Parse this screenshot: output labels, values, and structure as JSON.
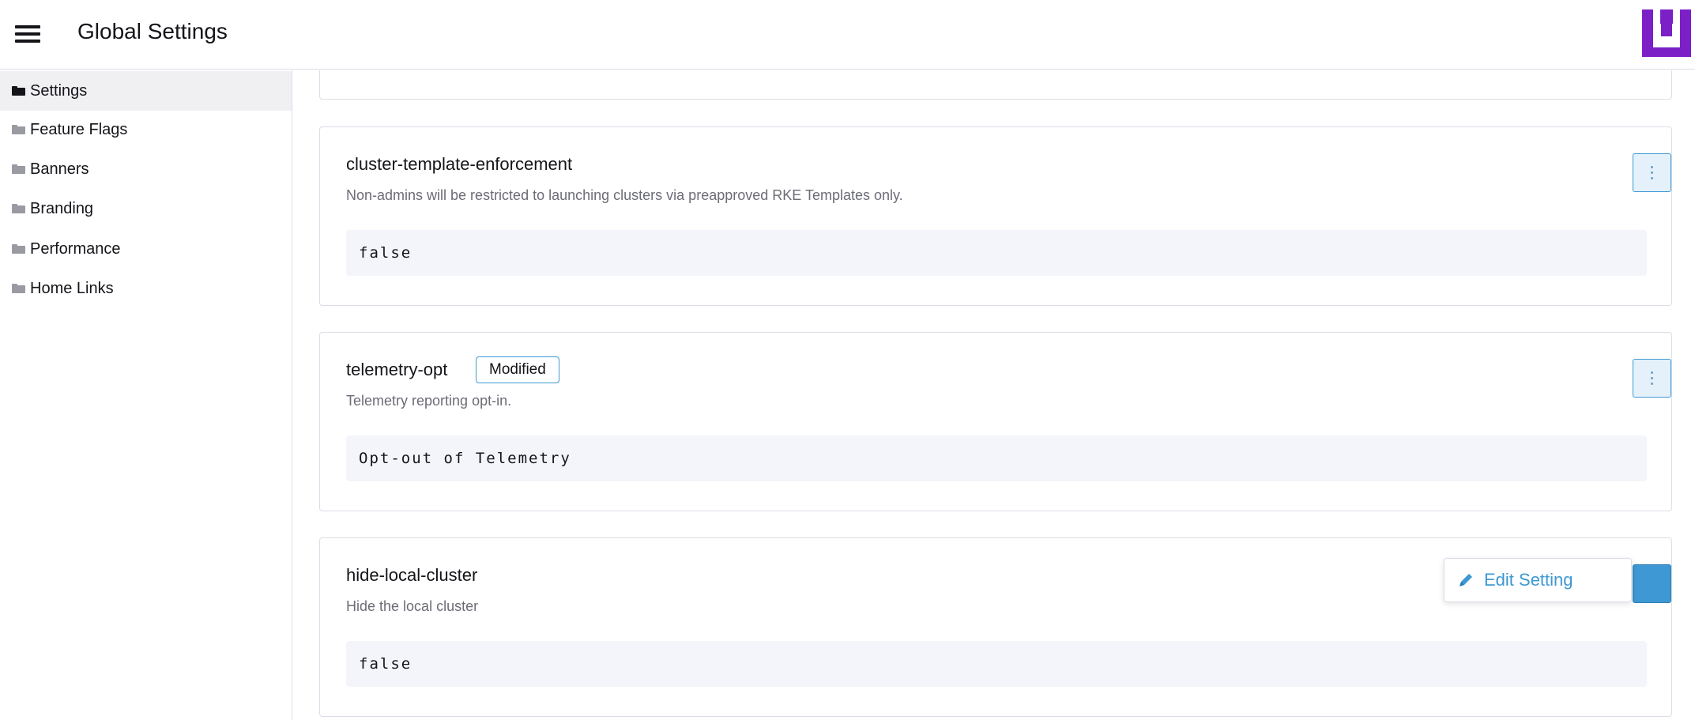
{
  "header": {
    "title": "Global Settings",
    "menu_icon": "hamburger-menu-icon",
    "logo_icon": "brand-logo-icon",
    "logo_color": "#7b1fc7"
  },
  "sidebar": {
    "items": [
      {
        "label": "Settings",
        "icon": "folder-open-icon",
        "active": true
      },
      {
        "label": "Feature Flags",
        "icon": "folder-icon",
        "active": false
      },
      {
        "label": "Banners",
        "icon": "folder-icon",
        "active": false
      },
      {
        "label": "Branding",
        "icon": "folder-icon",
        "active": false
      },
      {
        "label": "Performance",
        "icon": "folder-icon",
        "active": false
      },
      {
        "label": "Home Links",
        "icon": "folder-icon",
        "active": false
      }
    ]
  },
  "settings": [
    {
      "name": "cluster-template-enforcement",
      "description": "Non-admins will be restricted to launching clusters via preapproved RKE Templates only.",
      "value": "false"
    },
    {
      "name": "telemetry-opt",
      "badge": "Modified",
      "description": "Telemetry reporting opt-in.",
      "value": "Opt-out of Telemetry"
    },
    {
      "name": "hide-local-cluster",
      "description": "Hide the local cluster",
      "value": "false"
    }
  ],
  "action_menu": {
    "edit_label": "Edit Setting",
    "edit_icon": "pencil-icon"
  },
  "colors": {
    "accent": "#3d98d3",
    "badge_border": "#3d98d3",
    "value_bg": "#f4f5fa"
  }
}
